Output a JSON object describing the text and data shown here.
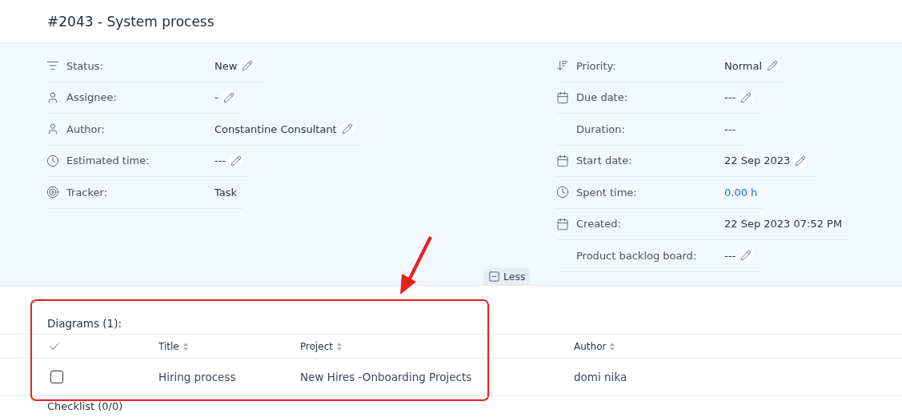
{
  "title": "#2043 - System process",
  "attributes_left": [
    {
      "kind": "status",
      "label": "Status:",
      "value": "New",
      "editable": true
    },
    {
      "kind": "person",
      "label": "Assignee:",
      "value": "-",
      "editable": true
    },
    {
      "kind": "person",
      "label": "Author:",
      "value": "Constantine Consultant",
      "editable": true
    },
    {
      "kind": "clock",
      "label": "Estimated time:",
      "value": "---",
      "editable": true
    },
    {
      "kind": "target",
      "label": "Tracker:",
      "value": "Task",
      "editable": false
    }
  ],
  "attributes_right": [
    {
      "kind": "priority",
      "label": "Priority:",
      "value": "Normal",
      "editable": true
    },
    {
      "kind": "calendar",
      "label": "Due date:",
      "value": "---",
      "editable": true
    },
    {
      "kind": "plain",
      "label": "Duration:",
      "value": "---",
      "editable": false
    },
    {
      "kind": "calendar",
      "label": "Start date:",
      "value": "22 Sep 2023",
      "editable": true
    },
    {
      "kind": "clock",
      "label": "Spent time:",
      "value": "0.00 h",
      "editable": false,
      "link": true
    },
    {
      "kind": "calendar",
      "label": "Created:",
      "value": "22 Sep 2023 07:52 PM",
      "editable": false
    },
    {
      "kind": "plain",
      "label": "Product backlog board:",
      "value": "---",
      "editable": true
    }
  ],
  "less_button": "Less",
  "diagrams": {
    "heading": "Diagrams (1):",
    "columns": [
      "Title",
      "Project",
      "Author"
    ],
    "rows": [
      {
        "checked": false,
        "title": "Hiring process",
        "project": "New Hires -Onboarding Projects",
        "author": "domi nika"
      }
    ]
  },
  "checklist_heading": "Checklist (0/0)"
}
